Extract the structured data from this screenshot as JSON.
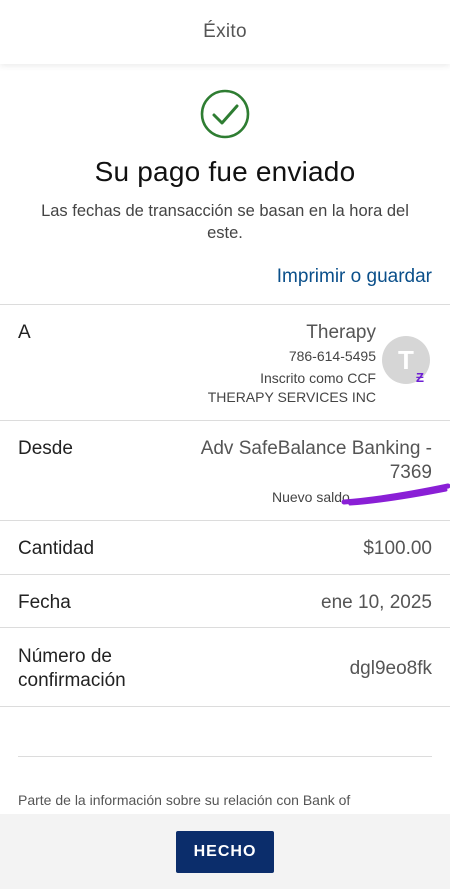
{
  "header": {
    "title": "Éxito"
  },
  "status": {
    "headline": "Su pago fue enviado",
    "subtitle": "Las fechas de transacción se basan en la hora del este.",
    "print_link": "Imprimir o guardar"
  },
  "details": {
    "to": {
      "label": "A",
      "name": "Therapy",
      "phone": "786-614-5495",
      "enrolled_as": "Inscrito como CCF",
      "business": "THERAPY SERVICES INC",
      "avatar_initial": "T",
      "badge_icon": "zelle-icon"
    },
    "from": {
      "label": "Desde",
      "account_line1": "Adv SafeBalance Banking -",
      "account_line2": "7369",
      "new_balance_label": "Nuevo saldo"
    },
    "amount": {
      "label": "Cantidad",
      "value": "$100.00"
    },
    "date": {
      "label": "Fecha",
      "value": "ene 10, 2025"
    },
    "confirmation": {
      "label_line1": "Número de",
      "label_line2": "confirmación",
      "value": "dgl9eo8fk"
    }
  },
  "footer": {
    "note": "Parte de la información sobre su relación con Bank of",
    "done_label": "HECHO"
  },
  "colors": {
    "link": "#0a4f8a",
    "success": "#2e7d32",
    "button": "#0b2d6b",
    "zelle": "#6d1ed4",
    "scribble": "#8a1fd6"
  }
}
